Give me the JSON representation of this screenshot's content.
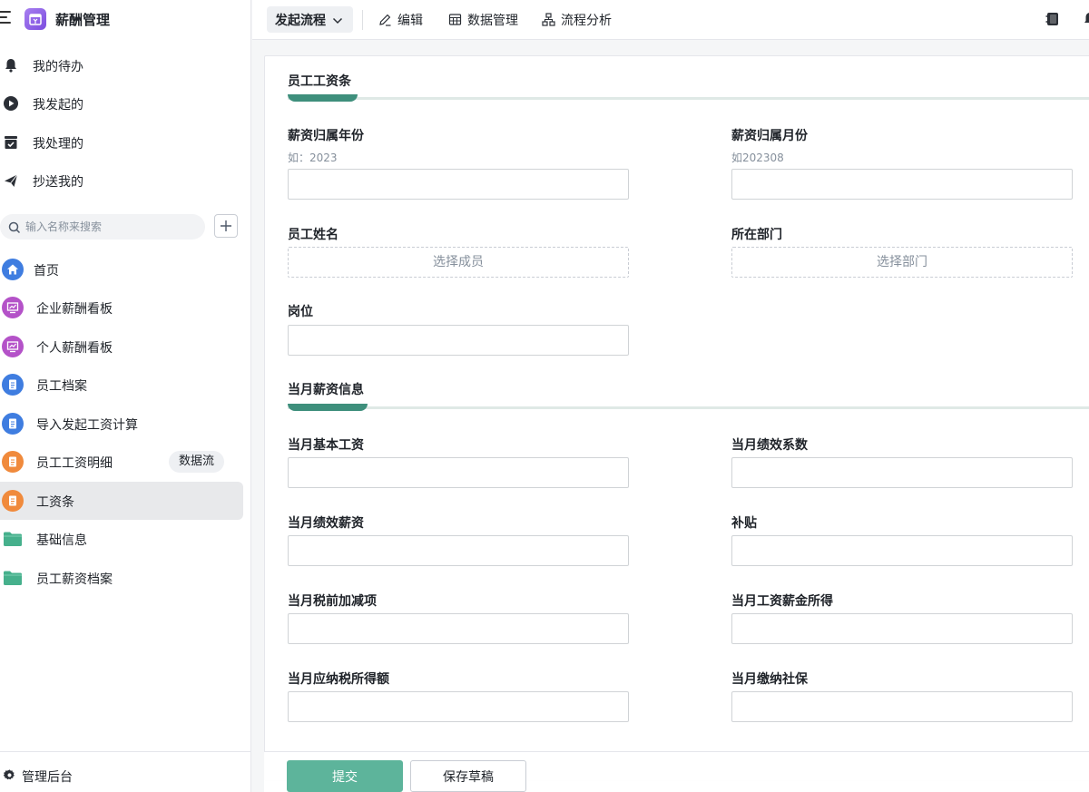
{
  "app": {
    "title": "薪酬管理",
    "logo_icon": "wallet-icon",
    "accent": "#7c4ddf"
  },
  "quick_nav": [
    {
      "label": "我的待办",
      "icon": "bell-icon"
    },
    {
      "label": "我发起的",
      "icon": "play-circle-icon"
    },
    {
      "label": "我处理的",
      "icon": "inbox-check-icon"
    },
    {
      "label": "抄送我的",
      "icon": "send-icon"
    }
  ],
  "search": {
    "placeholder": "输入名称来搜索"
  },
  "nav": [
    {
      "label": "首页",
      "icon": "home-icon",
      "color": "#3f7de0"
    },
    {
      "label": "企业薪酬看板",
      "icon": "dashboard-icon",
      "color": "#b452c8"
    },
    {
      "label": "个人薪酬看板",
      "icon": "dashboard-icon",
      "color": "#b452c8"
    },
    {
      "label": "员工档案",
      "icon": "form-icon",
      "color": "#3f7de0"
    },
    {
      "label": "导入发起工资计算",
      "icon": "form-icon",
      "color": "#3f7de0"
    },
    {
      "label": "员工工资明细",
      "icon": "form-icon",
      "color": "#f08a3c",
      "badge": "数据流"
    },
    {
      "label": "工资条",
      "icon": "form-icon",
      "color": "#f08a3c",
      "active": true
    },
    {
      "label": "基础信息",
      "icon": "folder-icon",
      "color": "#46b08c"
    },
    {
      "label": "员工薪资档案",
      "icon": "folder-icon",
      "color": "#46b08c"
    }
  ],
  "footer": {
    "label": "管理后台",
    "icon": "gear-icon"
  },
  "toolbar": {
    "launch_label": "发起流程",
    "edit_label": "编辑",
    "data_label": "数据管理",
    "analysis_label": "流程分析"
  },
  "form": {
    "section1": {
      "title": "员工工资条",
      "fields": {
        "year": {
          "label": "薪资归属年份",
          "hint": "如：2023",
          "value": ""
        },
        "month": {
          "label": "薪资归属月份",
          "hint": "如202308",
          "value": ""
        },
        "name": {
          "label": "员工姓名",
          "picker": "选择成员"
        },
        "dept": {
          "label": "所在部门",
          "picker": "选择部门"
        },
        "post": {
          "label": "岗位",
          "value": ""
        }
      }
    },
    "section2": {
      "title": "当月薪资信息",
      "fields": {
        "base": {
          "label": "当月基本工资",
          "value": ""
        },
        "coef": {
          "label": "当月绩效系数",
          "value": ""
        },
        "perf": {
          "label": "当月绩效薪资",
          "value": ""
        },
        "subsidy": {
          "label": "补贴",
          "value": ""
        },
        "adjust": {
          "label": "当月税前加减项",
          "value": ""
        },
        "income": {
          "label": "当月工资薪金所得",
          "value": ""
        },
        "taxable": {
          "label": "当月应纳税所得额",
          "value": ""
        },
        "social": {
          "label": "当月缴纳社保",
          "value": ""
        }
      }
    }
  },
  "actions": {
    "submit_label": "提交",
    "draft_label": "保存草稿",
    "submit_color": "#5db49b"
  }
}
